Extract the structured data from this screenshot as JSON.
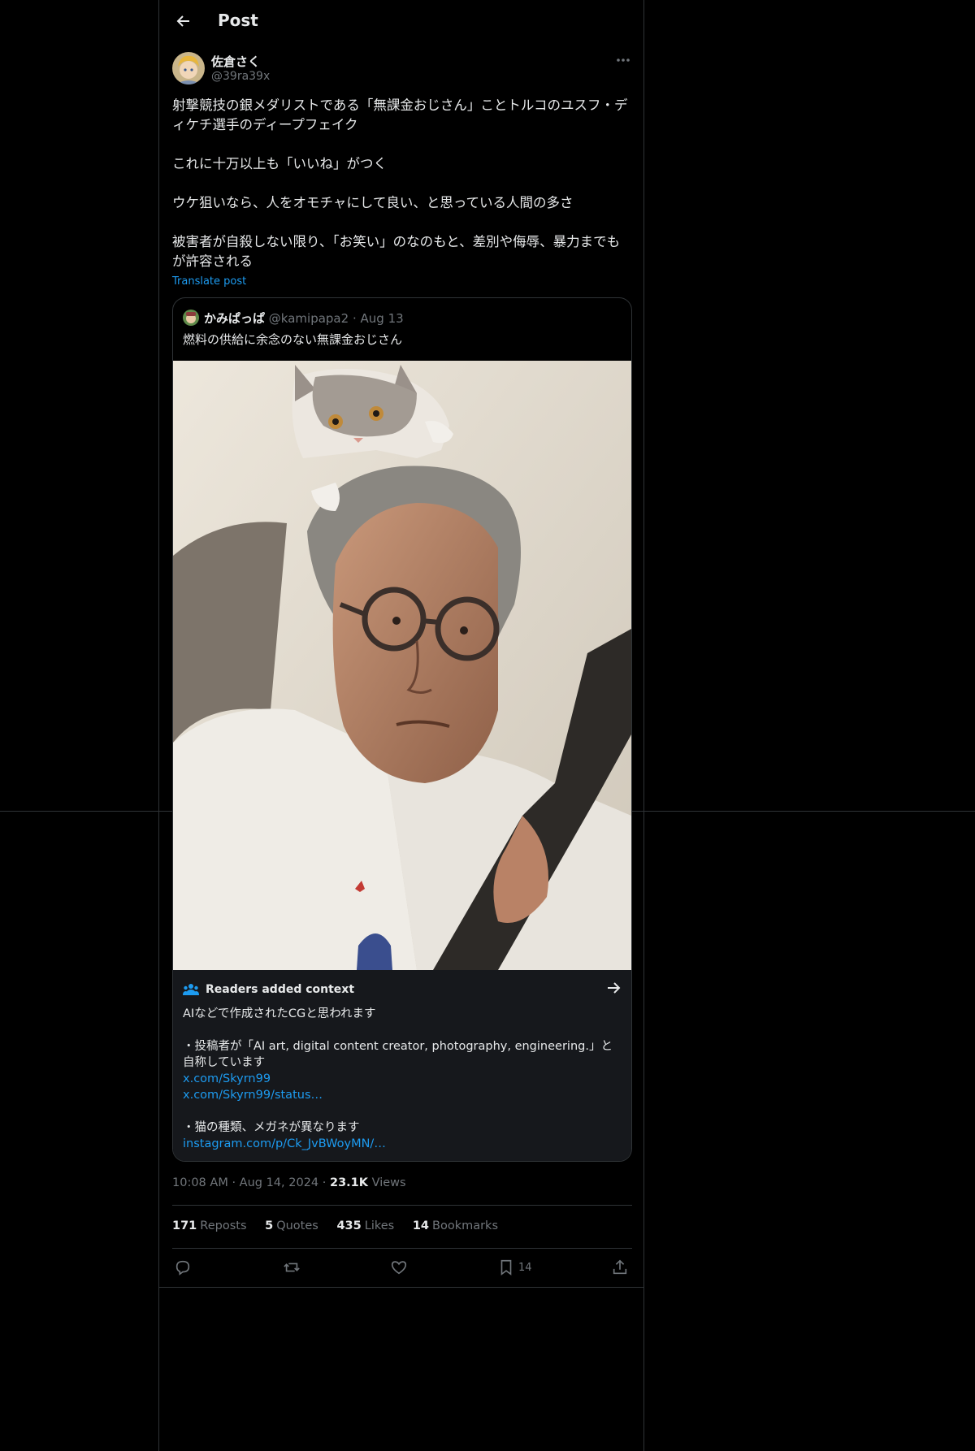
{
  "header": {
    "title": "Post"
  },
  "post": {
    "author": {
      "name": "佐倉さく",
      "handle": "@39ra39x"
    },
    "paragraphs": [
      "射撃競技の銀メダリストである「無課金おじさん」ことトルコのユスフ・ディケチ選手のディープフェイク",
      "これに十万以上も「いいね」がつく",
      "ウケ狙いなら、人をオモチャにして良い、と思っている人間の多さ",
      "被害者が自殺しない限り、「お笑い」のなのもと、差別や侮辱、暴力までもが許容される"
    ],
    "translate": "Translate post"
  },
  "quote": {
    "name": "かみぱっぱ",
    "handle": "@kamipapa2",
    "dot": "·",
    "date": "Aug 13",
    "text": "燃料の供給に余念のない無課金おじさん"
  },
  "context": {
    "title": "Readers added context",
    "line1": "AIなどで作成されたCGと思われます",
    "line2": "・投稿者が「AI art, digital content creator, photography, engineering.」と自称しています",
    "link1": "x.com/Skyrn99",
    "link2": "x.com/Skyrn99/status…",
    "line3": "・猫の種類、メガネが異なります",
    "link3": "instagram.com/p/Ck_JvBWoyMN/…"
  },
  "meta": {
    "time": "10:08 AM",
    "dot1": "·",
    "date": "Aug 14, 2024",
    "dot2": "·",
    "views_count": "23.1K",
    "views_label": "Views"
  },
  "stats": {
    "reposts_count": "171",
    "reposts_label": "Reposts",
    "quotes_count": "5",
    "quotes_label": "Quotes",
    "likes_count": "435",
    "likes_label": "Likes",
    "bookmarks_count": "14",
    "bookmarks_label": "Bookmarks"
  },
  "actions": {
    "reply_icon": "reply-icon",
    "repost_icon": "repost-icon",
    "like_icon": "heart-icon",
    "bookmark_icon": "bookmark-icon",
    "bookmark_count": "14",
    "share_icon": "share-icon"
  },
  "colors": {
    "accent": "#1d9bf0",
    "muted": "#71767b",
    "text": "#e7e9ea",
    "border": "#2f3336",
    "context_bg": "#16181c"
  }
}
